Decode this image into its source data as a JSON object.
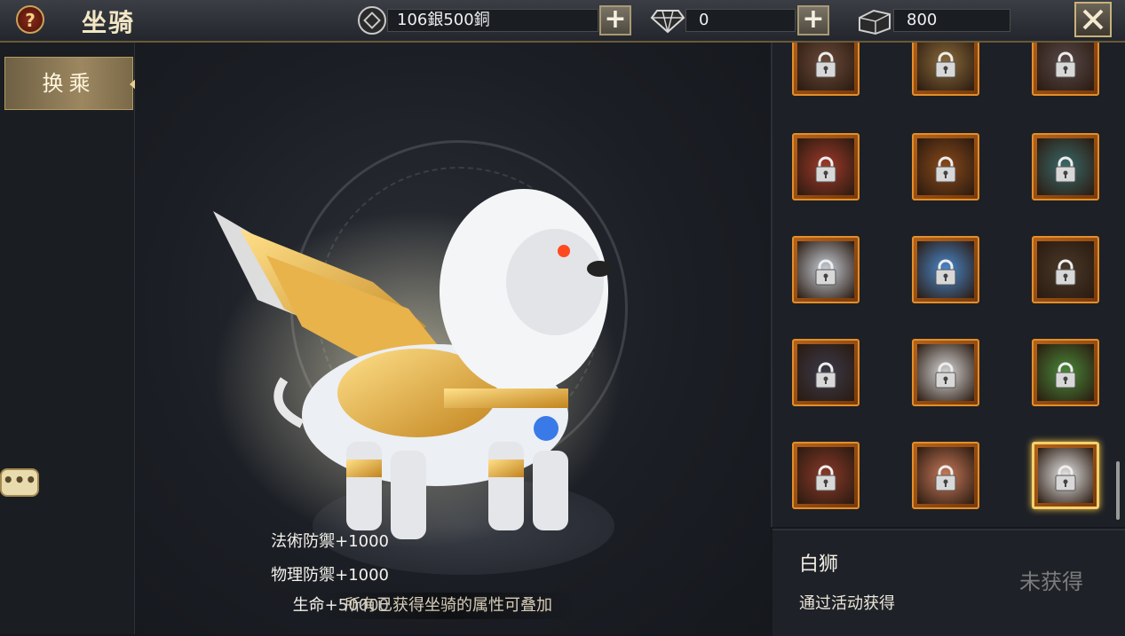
{
  "header": {
    "title": "坐骑",
    "silver_copper": "106銀500銅",
    "diamonds": "0",
    "tokens": "800",
    "help_icon": "?",
    "close_icon": "close-icon"
  },
  "sidebar": {
    "tabs": [
      {
        "label": "换乘"
      }
    ]
  },
  "stage": {
    "stats": [
      "法術防禦+1000",
      "物理防禦+1000",
      "生命+50000"
    ],
    "note": "所有已获得坐骑的属性可叠加"
  },
  "mount_grid": {
    "items": [
      {
        "name": "mount-1",
        "locked": true,
        "color": "#6a4a3a"
      },
      {
        "name": "mount-2",
        "locked": true,
        "color": "#8a6a3a"
      },
      {
        "name": "mount-3",
        "locked": true,
        "color": "#5a4a4a"
      },
      {
        "name": "mount-4",
        "locked": true,
        "color": "#a03a2a"
      },
      {
        "name": "mount-5",
        "locked": true,
        "color": "#8a4a1a"
      },
      {
        "name": "mount-6",
        "locked": true,
        "color": "#3a6a6a"
      },
      {
        "name": "mount-7",
        "locked": true,
        "color": "#c8d0da"
      },
      {
        "name": "mount-8",
        "locked": true,
        "color": "#4a8acf"
      },
      {
        "name": "mount-9",
        "locked": true,
        "color": "#4a3a2a"
      },
      {
        "name": "mount-10",
        "locked": true,
        "color": "#3a3a4a"
      },
      {
        "name": "mount-11",
        "locked": true,
        "color": "#d8d8d8"
      },
      {
        "name": "mount-12",
        "locked": true,
        "color": "#4a8a3a"
      },
      {
        "name": "mount-13",
        "locked": true,
        "color": "#8a3a2a"
      },
      {
        "name": "mount-14",
        "locked": true,
        "color": "#c87a5a"
      },
      {
        "name": "mount-15",
        "locked": true,
        "color": "#e8e8e8",
        "selected": true
      }
    ]
  },
  "selected_mount": {
    "name": "白狮",
    "source": "通过活动获得",
    "status": "未获得"
  },
  "chat": {
    "icon": "•••"
  }
}
